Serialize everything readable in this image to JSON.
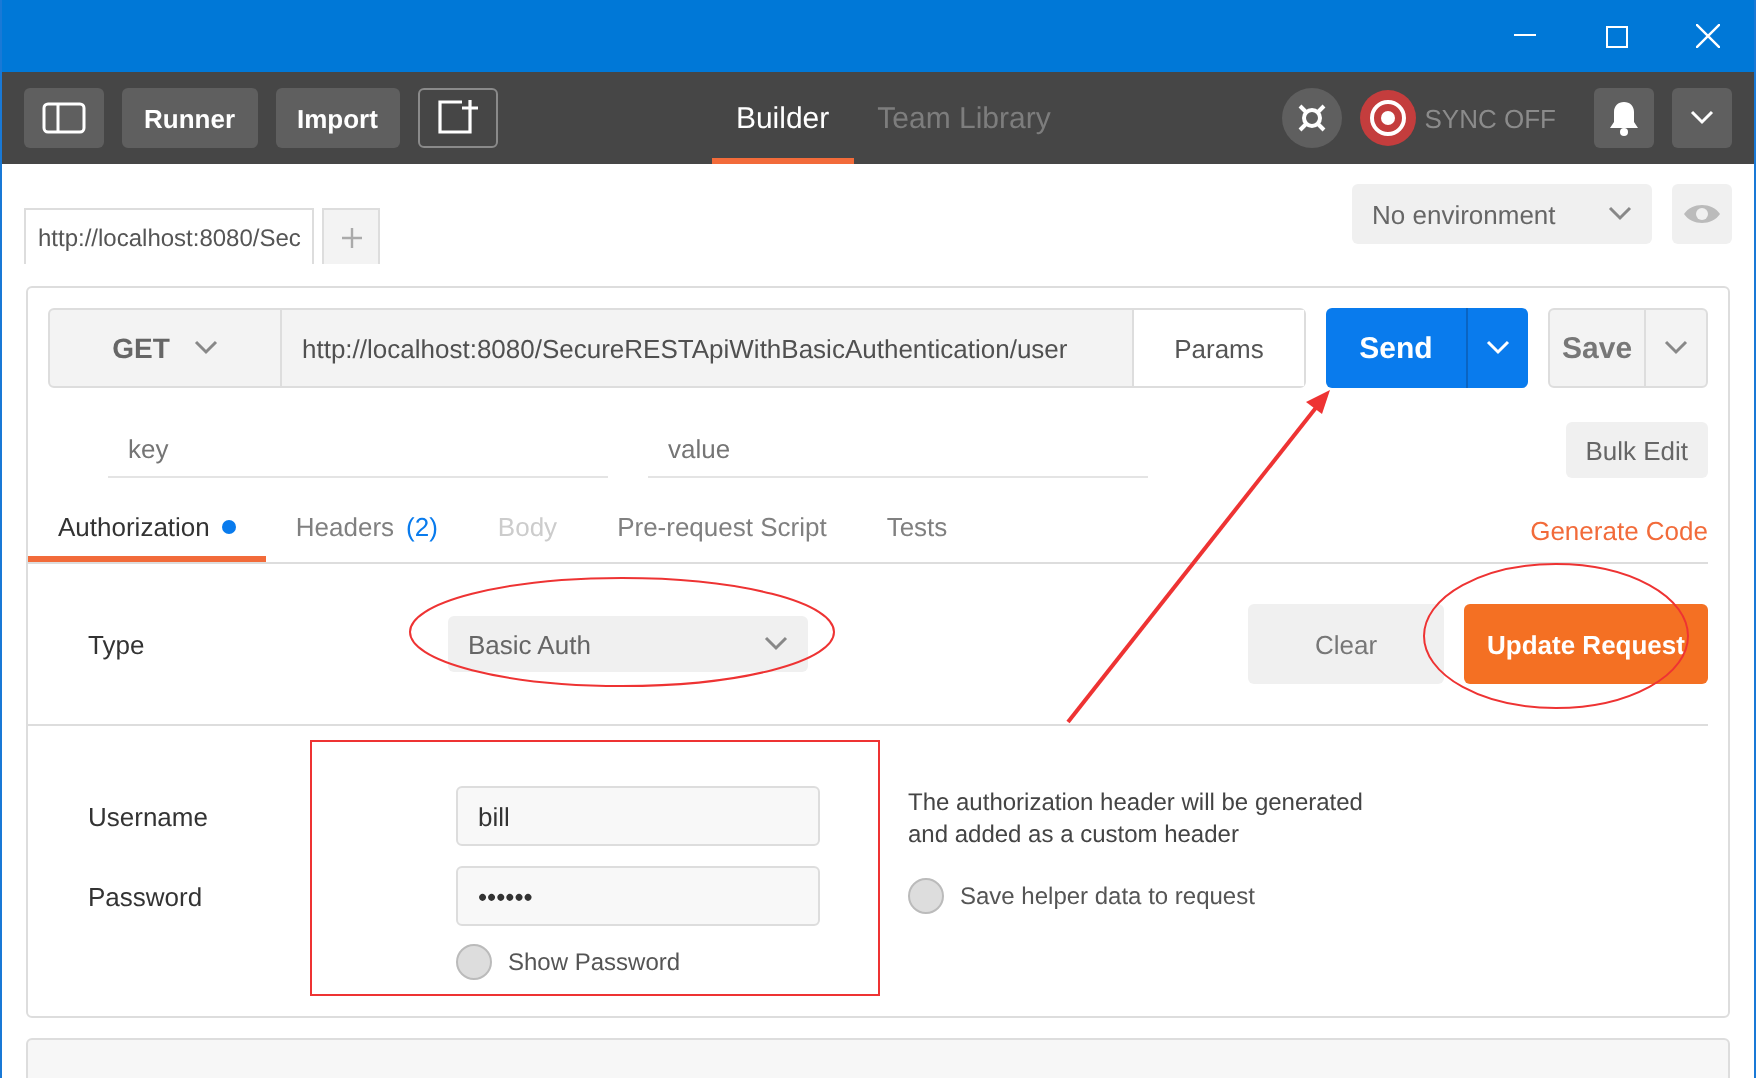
{
  "toolbar": {
    "buttons": [
      "Runner",
      "Import"
    ],
    "tabs": [
      {
        "label": "Builder",
        "selected": true
      },
      {
        "label": "Team Library",
        "selected": false
      }
    ],
    "sync": "SYNC OFF"
  },
  "request_tabs": [
    {
      "label": "http://localhost:8080/Sec",
      "selected": true
    }
  ],
  "environment": {
    "value": "No environment"
  },
  "request": {
    "method": "GET",
    "url": "http://localhost:8080/SecureRESTApiWithBasicAuthentication/user",
    "params": "Params",
    "send": "Send",
    "save": "Save"
  },
  "params_row": {
    "key_placeholder": "key",
    "value_placeholder": "value",
    "bulk_edit": "Bulk Edit"
  },
  "section_tabs": [
    {
      "label": "Authorization",
      "selected": true,
      "disabled": false,
      "modified": true
    },
    {
      "label": "Headers",
      "count": "(2)",
      "selected": false,
      "disabled": false,
      "modified": false
    },
    {
      "label": "Body",
      "selected": false,
      "disabled": true,
      "modified": false
    },
    {
      "label": "Pre-request Script",
      "selected": false,
      "disabled": false,
      "modified": false
    },
    {
      "label": "Tests",
      "selected": false,
      "disabled": false,
      "modified": false
    }
  ],
  "generate_code": "Generate Code",
  "auth": {
    "type_label": "Type",
    "type_value": "Basic Auth",
    "clear": "Clear",
    "update": "Update Request",
    "username_label": "Username",
    "username": "bill",
    "password_label": "Password",
    "password": "••••••",
    "show_password": {
      "label": "Show Password",
      "checked": false
    },
    "note": "The authorization header will be generated and added as a custom header",
    "save_helper": {
      "label": "Save helper data to request",
      "checked": false
    }
  }
}
